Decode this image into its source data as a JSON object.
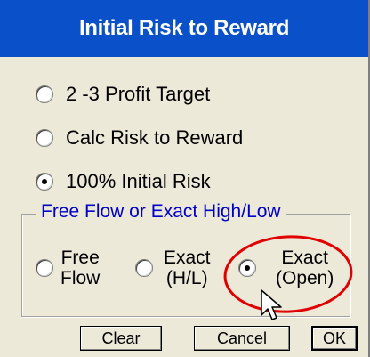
{
  "dialog": {
    "title": "Initial Risk to Reward"
  },
  "options": [
    {
      "label": "2 -3 Profit Target",
      "checked": false
    },
    {
      "label": "Calc Risk to Reward",
      "checked": false
    },
    {
      "label": "100% Initial Risk",
      "checked": true
    }
  ],
  "group": {
    "legend": "Free Flow or Exact High/Low",
    "choices": [
      {
        "line1": "Free",
        "line2": "Flow",
        "checked": false
      },
      {
        "line1": "Exact",
        "line2": "(H/L)",
        "checked": false
      },
      {
        "line1": "Exact",
        "line2": "(Open)",
        "checked": true
      }
    ]
  },
  "buttons": {
    "clear": "Clear",
    "cancel": "Cancel",
    "ok": "OK"
  },
  "colors": {
    "title_bar": "#0a50c8",
    "dialog_bg": "#ece9d8",
    "legend_text": "#0000c8",
    "annotation": "#e00000"
  },
  "icons": [
    "radio-icon",
    "arrow-cursor-icon"
  ]
}
